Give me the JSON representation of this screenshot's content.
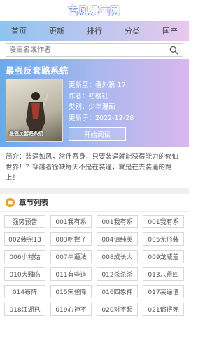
{
  "header": {
    "logo_text": "古风漫画网"
  },
  "nav": {
    "items": [
      "首页",
      "更新",
      "排行",
      "分类",
      "国产"
    ]
  },
  "search": {
    "placeholder": "漫画名或作者"
  },
  "comic": {
    "title": "最强反套路系统",
    "cover_text": "最强反套路系统",
    "latest": "更新至：番外篇 17",
    "author": "作者：初樱社",
    "category": "类别：少年漫画",
    "updated": "更新于：2022-12-28",
    "read_button": "开始阅读",
    "summary": "简介：装逼如风，常伴吾身，只要装逼就能获得能力的修仙世界！？穿越者徐缺每天不是在装逼，就是在去装逼的路上！"
  },
  "chapters": {
    "title": "章节列表",
    "items": [
      "强势预告",
      "001我有系",
      "001我有系",
      "001我有系",
      "002装完13",
      "003吃撑了",
      "004请纯美",
      "005无形装",
      "006小村姑",
      "007牛逼法",
      "008成长大",
      "009龙威盖",
      "010大雅临",
      "011有些道",
      "012杀杀杀",
      "013八荒四",
      "014布阵",
      "015宋雀降",
      "016四象神",
      "017装逼值",
      "018江湖已",
      "019心神不",
      "020对不起",
      "021都得死"
    ]
  },
  "colors": {
    "nav_start": "#8fc4ef",
    "nav_end": "#e9c8ee",
    "hero_start": "#6aa9ea",
    "hero_end": "#d9b7ee",
    "accent_orange": "#f39a2b"
  }
}
